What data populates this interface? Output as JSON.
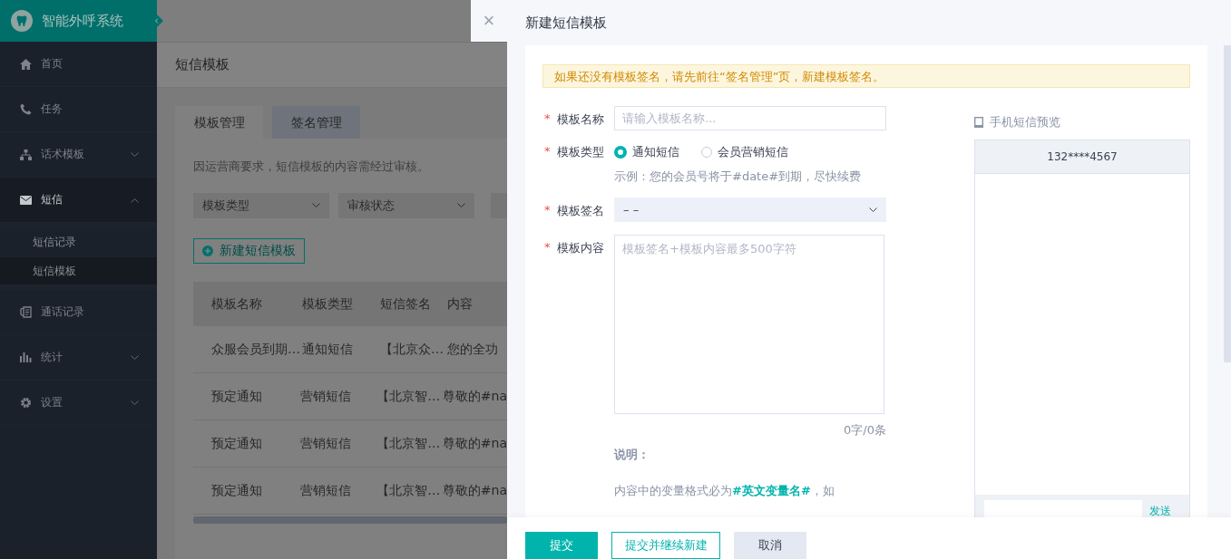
{
  "app": {
    "title": "智能外呼系统"
  },
  "sidebar": {
    "items": [
      {
        "label": "首页",
        "selected": false
      },
      {
        "label": "任务",
        "selected": false
      },
      {
        "label": "话术模板",
        "expanded": false,
        "selected": false
      },
      {
        "label": "短信",
        "expanded": true,
        "selected": true,
        "children": [
          {
            "label": "短信记录",
            "selected": false
          },
          {
            "label": "短信模板",
            "selected": true
          }
        ]
      },
      {
        "label": "通话记录",
        "selected": false
      },
      {
        "label": "统计",
        "expanded": false,
        "selected": false
      },
      {
        "label": "设置",
        "expanded": false,
        "selected": false
      }
    ]
  },
  "page": {
    "title": "短信模板",
    "tabs": [
      {
        "label": "模板管理",
        "selected": true
      },
      {
        "label": "签名管理",
        "selected": false
      }
    ],
    "notice": "因运营商要求，短信模板的内容需经过审核。",
    "filters": [
      {
        "label": "模板类型"
      },
      {
        "label": "审核状态"
      }
    ],
    "new_button": "新建短信模板",
    "table": {
      "columns": [
        "模板名称",
        "模板类型",
        "短信签名",
        "内容"
      ],
      "rows": [
        [
          "众服会员到期…",
          "通知短信",
          "【北京众…",
          "您的全功"
        ],
        [
          "预定通知",
          "营销短信",
          "【北京智…",
          "尊敬的#na"
        ],
        [
          "预定通知",
          "营销短信",
          "【北京智…",
          "尊敬的#na"
        ],
        [
          "预定通知",
          "营销短信",
          "【北京智…",
          "尊敬的#na"
        ]
      ]
    }
  },
  "drawer": {
    "close": "×",
    "title": "新建短信模板",
    "warning": "如果还没有模板签名，请先前往“签名管理”页，新建模板签名。",
    "form": {
      "name": {
        "required_mark": "*",
        "label": "模板名称",
        "placeholder": "请输入模板名称..."
      },
      "type": {
        "required_mark": "*",
        "label": "模板类型",
        "options": [
          {
            "label": "通知短信",
            "selected": true
          },
          {
            "label": "会员营销短信",
            "selected": false
          }
        ],
        "example": "示例：您的会员号将于#date#到期，尽快续费"
      },
      "signature": {
        "required_mark": "*",
        "label": "模板签名",
        "value": "– –"
      },
      "content": {
        "required_mark": "*",
        "label": "模板内容",
        "placeholder": "模板签名+模板内容最多500字符",
        "count": "0字/0条"
      },
      "note_title": "说明：",
      "note": "内容中的变量格式必为**#英文变量名#**，如"
    },
    "preview": {
      "title": "手机短信预览",
      "number": "132****4567",
      "send": "发送"
    },
    "buttons": [
      {
        "label": "提交",
        "kind": "primary"
      },
      {
        "label": "提交并继续新建",
        "kind": "outline"
      },
      {
        "label": "取消",
        "kind": "plain"
      }
    ]
  }
}
